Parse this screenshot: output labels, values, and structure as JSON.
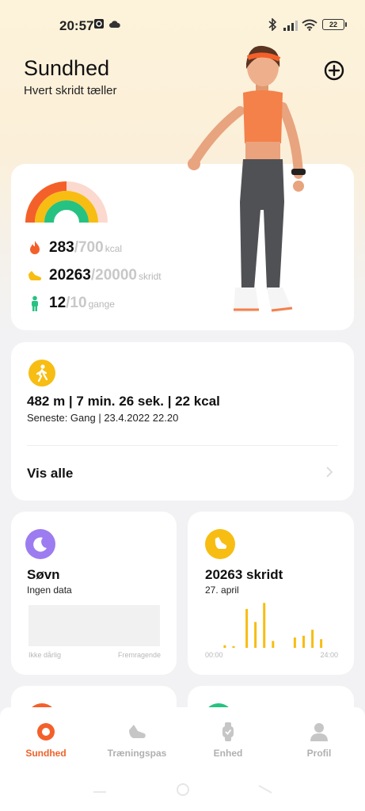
{
  "status_bar": {
    "time": "20:57",
    "battery": "22"
  },
  "header": {
    "title": "Sundhed",
    "subtitle": "Hvert skridt tæller"
  },
  "summary": {
    "calories": {
      "value": "283",
      "goal": "/700",
      "unit": "kcal",
      "color": "#f4602a"
    },
    "steps": {
      "value": "20263",
      "goal": "/20000",
      "unit": "skridt",
      "color": "#f7bd12"
    },
    "standing": {
      "value": "12",
      "goal": "/10",
      "unit": "gange",
      "color": "#26c281"
    }
  },
  "activity": {
    "main": "482 m | 7 min. 26 sek. | 22 kcal",
    "sub": "Seneste: Gang | 23.4.2022 22.20",
    "show_all": "Vis alle"
  },
  "sleep": {
    "title": "Søvn",
    "sub": "Ingen data",
    "axis_left": "Ikke dårlig",
    "axis_right": "Fremragende"
  },
  "steps_card": {
    "title": "20263 skridt",
    "date": "27. april",
    "axis_left": "00:00",
    "axis_right": "24:00"
  },
  "chart_data": {
    "type": "bar",
    "title": "20263 skridt",
    "xlabel": "",
    "ylabel": "",
    "x_range_labels": [
      "00:00",
      "24:00"
    ],
    "values": [
      0,
      0,
      0,
      0,
      0,
      0,
      0,
      0,
      0,
      0,
      0,
      0,
      0,
      0,
      0,
      0,
      0,
      0,
      0,
      0,
      0,
      0,
      0,
      0,
      0,
      0,
      0,
      0,
      0,
      0,
      0,
      0,
      0,
      0,
      0,
      0,
      0,
      0,
      0,
      0,
      0,
      0,
      0,
      0,
      0,
      0,
      0,
      0,
      0,
      0,
      0,
      0,
      0,
      0,
      0,
      0,
      0,
      0,
      0,
      0,
      0,
      0,
      0,
      0,
      0,
      0,
      0,
      0,
      0,
      0,
      0,
      0,
      0,
      0,
      0,
      0,
      0,
      0,
      0,
      0,
      0,
      0,
      0,
      0,
      0,
      0,
      0,
      0,
      0,
      0,
      0,
      0,
      0,
      0,
      0,
      0,
      0,
      0,
      0,
      0,
      0,
      0,
      0,
      0,
      0,
      0,
      0,
      0,
      0,
      0,
      0,
      0,
      0,
      0,
      0,
      0,
      0,
      0,
      0,
      0,
      0,
      0,
      0,
      0,
      0,
      0,
      0,
      0,
      0,
      0,
      0,
      0,
      0,
      0,
      0,
      0,
      0,
      0,
      0,
      0,
      0,
      0,
      0,
      0,
      0
    ],
    "bars": [
      {
        "slot": 4,
        "value": 3
      },
      {
        "slot": 6,
        "value": 2
      },
      {
        "slot": 9,
        "value": 45
      },
      {
        "slot": 11,
        "value": 30
      },
      {
        "slot": 13,
        "value": 52
      },
      {
        "slot": 15,
        "value": 8
      },
      {
        "slot": 20,
        "value": 12
      },
      {
        "slot": 22,
        "value": 14
      },
      {
        "slot": 24,
        "value": 21
      },
      {
        "slot": 26,
        "value": 10
      }
    ],
    "slots": 30,
    "ylim": [
      0,
      55
    ],
    "color": "#f7bd12"
  },
  "nav": {
    "items": [
      {
        "label": "Sundhed",
        "icon": "health-icon",
        "active": true
      },
      {
        "label": "Træningspas",
        "icon": "shoe-icon",
        "active": false
      },
      {
        "label": "Enhed",
        "icon": "watch-icon",
        "active": false
      },
      {
        "label": "Profil",
        "icon": "profile-icon",
        "active": false
      }
    ]
  }
}
